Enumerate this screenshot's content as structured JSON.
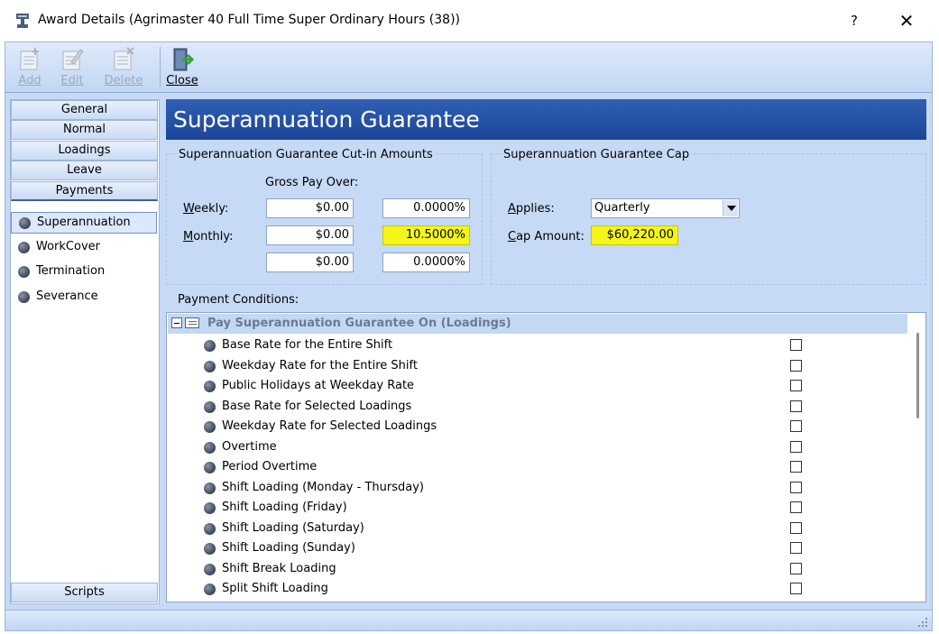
{
  "window": {
    "title": "Award Details (Agrimaster 40 Full Time Super Ordinary Hours (38))",
    "help": "?",
    "close": "✕"
  },
  "toolbar": {
    "add": "Add",
    "edit": "Edit",
    "delete": "Delete",
    "close": "Close"
  },
  "nav": {
    "tabs": [
      "General",
      "Normal",
      "Loadings",
      "Leave",
      "Payments"
    ],
    "active_tab": "Payments",
    "items": [
      "Superannuation",
      "WorkCover",
      "Termination",
      "Severance"
    ],
    "selected_item": "Superannuation",
    "scripts": "Scripts"
  },
  "main": {
    "heading": "Superannuation Guarantee",
    "cutin": {
      "title": "Superannuation Guarantee Cut-in Amounts",
      "gross_pay_over": "Gross Pay Over:",
      "weekly_label_u": "W",
      "weekly_label_rest": "eekly:",
      "monthly_label_u": "M",
      "monthly_label_rest": "onthly:",
      "rows": [
        {
          "amount": "$0.00",
          "percent": "0.0000%"
        },
        {
          "amount": "$0.00",
          "percent": "10.5000%"
        },
        {
          "amount": "$0.00",
          "percent": "0.0000%"
        }
      ]
    },
    "cap": {
      "title": "Superannuation Guarantee Cap",
      "applies_u": "A",
      "applies_rest": "pplies:",
      "applies_value": "Quarterly",
      "cap_amount_u": "C",
      "cap_amount_rest": "ap Amount:",
      "cap_amount_value": "$60,220.00"
    },
    "payment_conditions_label": "Payment Conditions:",
    "tree": {
      "header": "Pay Superannuation Guarantee On (Loadings)",
      "items": [
        "Base Rate for the Entire Shift",
        "Weekday Rate for the Entire Shift",
        "Public Holidays at Weekday Rate",
        "Base Rate for Selected Loadings",
        "Weekday Rate for Selected Loadings",
        "Overtime",
        "Period Overtime",
        "Shift Loading (Monday - Thursday)",
        "Shift Loading (Friday)",
        "Shift Loading (Saturday)",
        "Shift Loading (Sunday)",
        "Shift Break Loading",
        "Split Shift Loading"
      ]
    }
  },
  "colors": {
    "heading_bg": "#2452a8",
    "highlight": "#f4f51a",
    "frame": "#c6d9f5"
  }
}
